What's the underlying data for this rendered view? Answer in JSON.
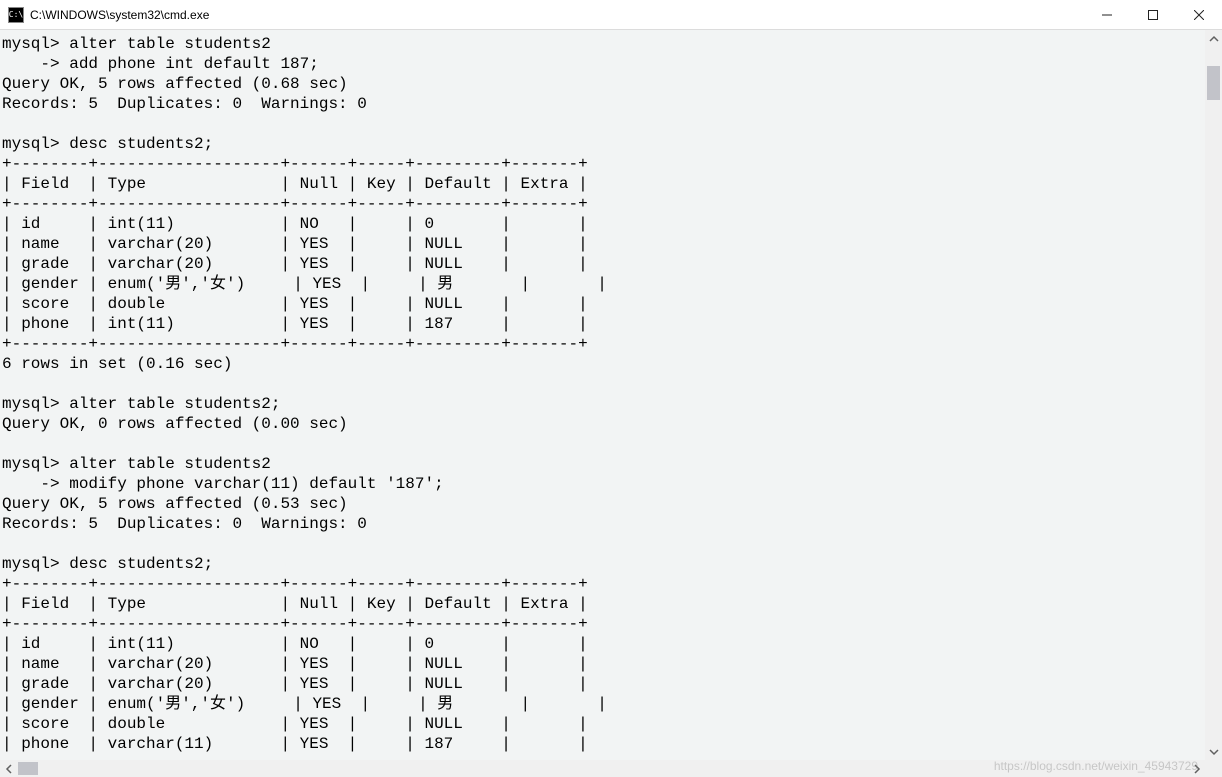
{
  "window": {
    "title": "C:\\WINDOWS\\system32\\cmd.exe",
    "icon_label": "cmd-icon"
  },
  "prompt": "mysql>",
  "cont_prompt": "    ->",
  "session": {
    "cmd1": {
      "line1": "alter table students2",
      "line2": "add phone int default 187;",
      "result1": "Query OK, 5 rows affected (0.68 sec)",
      "result2": "Records: 5  Duplicates: 0  Warnings: 0"
    },
    "cmd2": {
      "line": "desc students2;",
      "footer": "6 rows in set (0.16 sec)"
    },
    "table1": {
      "headers": [
        "Field",
        "Type",
        "Null",
        "Key",
        "Default",
        "Extra"
      ],
      "rows": [
        {
          "field": "id",
          "type": "int(11)",
          "null": "NO",
          "key": "",
          "default": "0",
          "extra": ""
        },
        {
          "field": "name",
          "type": "varchar(20)",
          "null": "YES",
          "key": "",
          "default": "NULL",
          "extra": ""
        },
        {
          "field": "grade",
          "type": "varchar(20)",
          "null": "YES",
          "key": "",
          "default": "NULL",
          "extra": ""
        },
        {
          "field": "gender",
          "type": "enum('男','女')",
          "null": "YES",
          "key": "",
          "default": "男",
          "extra": ""
        },
        {
          "field": "score",
          "type": "double",
          "null": "YES",
          "key": "",
          "default": "NULL",
          "extra": ""
        },
        {
          "field": "phone",
          "type": "int(11)",
          "null": "YES",
          "key": "",
          "default": "187",
          "extra": ""
        }
      ]
    },
    "cmd3": {
      "line": "alter table students2;",
      "result": "Query OK, 0 rows affected (0.00 sec)"
    },
    "cmd4": {
      "line1": "alter table students2",
      "line2": "modify phone varchar(11) default '187';",
      "result1": "Query OK, 5 rows affected (0.53 sec)",
      "result2": "Records: 5  Duplicates: 0  Warnings: 0"
    },
    "cmd5": {
      "line": "desc students2;"
    },
    "table2": {
      "headers": [
        "Field",
        "Type",
        "Null",
        "Key",
        "Default",
        "Extra"
      ],
      "rows": [
        {
          "field": "id",
          "type": "int(11)",
          "null": "NO",
          "key": "",
          "default": "0",
          "extra": ""
        },
        {
          "field": "name",
          "type": "varchar(20)",
          "null": "YES",
          "key": "",
          "default": "NULL",
          "extra": ""
        },
        {
          "field": "grade",
          "type": "varchar(20)",
          "null": "YES",
          "key": "",
          "default": "NULL",
          "extra": ""
        },
        {
          "field": "gender",
          "type": "enum('男','女')",
          "null": "YES",
          "key": "",
          "default": "男",
          "extra": ""
        },
        {
          "field": "score",
          "type": "double",
          "null": "YES",
          "key": "",
          "default": "NULL",
          "extra": ""
        },
        {
          "field": "phone",
          "type": "varchar(11)",
          "null": "YES",
          "key": "",
          "default": "187",
          "extra": ""
        }
      ]
    }
  },
  "table_format": {
    "widths": {
      "field": 8,
      "type": 19,
      "null": 6,
      "key": 5,
      "default": 9,
      "extra": 7
    },
    "sep": "+--------+-------------------+------+-----+---------+-------+"
  },
  "watermark": "https://blog.csdn.net/weixin_45943729"
}
